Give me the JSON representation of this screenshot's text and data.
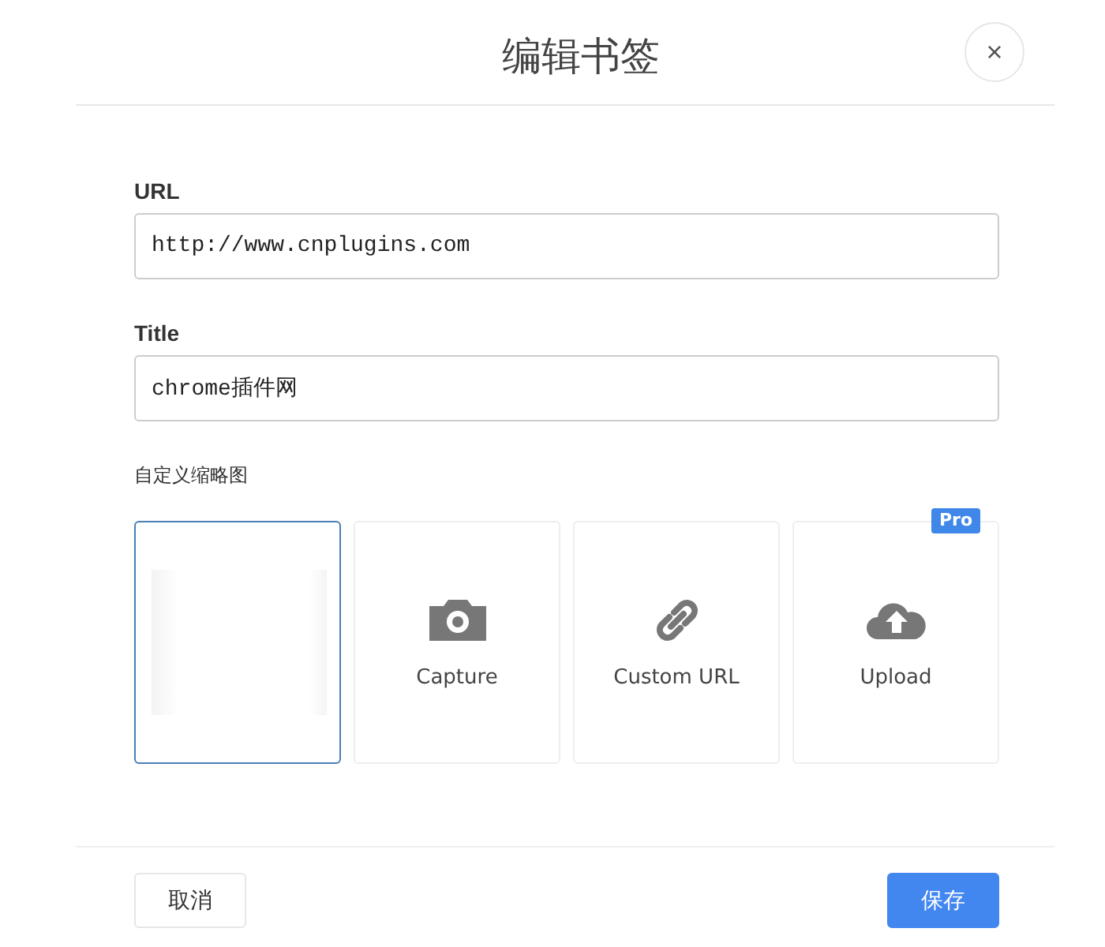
{
  "dialog": {
    "title": "编辑书签",
    "close": "×"
  },
  "fields": [
    {
      "label": "URL",
      "value": "http://www.cnplugins.com"
    },
    {
      "label": "Title",
      "value": "chrome插件网"
    }
  ],
  "thumbnail": {
    "label": "自定义缩略图",
    "options": [
      {
        "kind": "blank",
        "selected": true
      },
      {
        "kind": "capture",
        "label": "Capture",
        "selected": false
      },
      {
        "kind": "link",
        "label": "Custom URL",
        "selected": false
      },
      {
        "kind": "upload",
        "label": "Upload",
        "selected": false,
        "badge": "Pro"
      }
    ]
  },
  "buttons": {
    "cancel": "取消",
    "save": "保存"
  }
}
